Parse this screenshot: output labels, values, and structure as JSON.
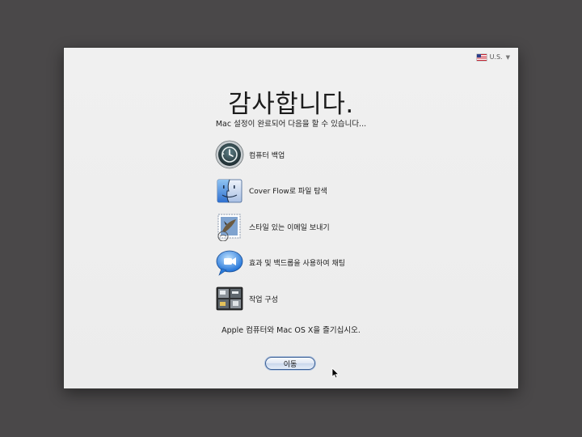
{
  "language": {
    "label": "U.S.",
    "flag_icon": "us-flag-icon",
    "caret_icon": "chevron-down-icon"
  },
  "title": "감사합니다.",
  "subtitle": "Mac 설정이 완료되어 다음을 할 수 있습니다...",
  "features": [
    {
      "icon": "time-machine-icon",
      "label": "컴퓨터 백업"
    },
    {
      "icon": "finder-icon",
      "label": "Cover Flow로 파일 탐색"
    },
    {
      "icon": "mail-stamp-icon",
      "label": "스타일 있는 이메일 보내기"
    },
    {
      "icon": "ichat-icon",
      "label": "효과 및 백드롭을 사용하여 채팅"
    },
    {
      "icon": "spaces-icon",
      "label": "작업 구성"
    }
  ],
  "footer_text": "Apple 컴퓨터와 Mac OS X을 즐기십시오.",
  "go_button_label": "이동",
  "colors": {
    "background": "#4a4849",
    "window": "#ececec",
    "button_border": "#3a5f95"
  }
}
